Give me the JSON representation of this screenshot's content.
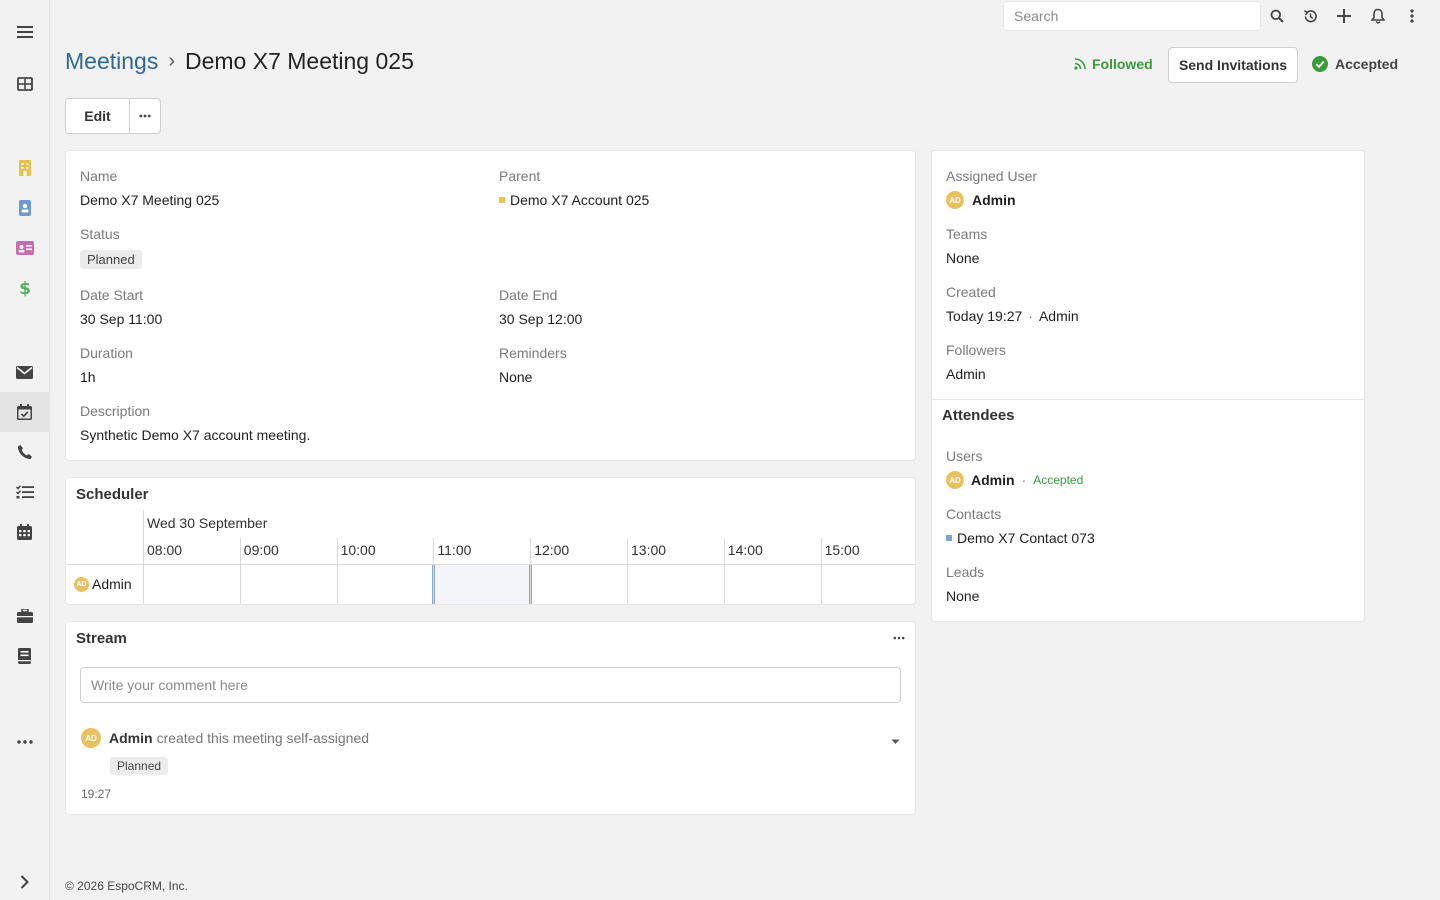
{
  "topbar": {
    "search_placeholder": "Search"
  },
  "header": {
    "breadcrumb_parent": "Meetings",
    "breadcrumb_separator": "›",
    "title": "Demo X7 Meeting 025",
    "followed_label": "Followed",
    "send_invitations_label": "Send Invitations",
    "acceptance_label": "Accepted",
    "edit_label": "Edit"
  },
  "details": {
    "name_label": "Name",
    "name_value": "Demo X7 Meeting 025",
    "parent_label": "Parent",
    "parent_value": "Demo X7 Account 025",
    "status_label": "Status",
    "status_value": "Planned",
    "date_start_label": "Date Start",
    "date_start_value": "30 Sep 11:00",
    "date_end_label": "Date End",
    "date_end_value": "30 Sep 12:00",
    "duration_label": "Duration",
    "duration_value": "1h",
    "reminders_label": "Reminders",
    "reminders_value": "None",
    "description_label": "Description",
    "description_value": "Synthetic Demo X7 account meeting."
  },
  "side": {
    "assigned_user_label": "Assigned User",
    "assigned_user_value": "Admin",
    "avatar_initials": "AD",
    "teams_label": "Teams",
    "teams_value": "None",
    "created_label": "Created",
    "created_time": "Today 19:27",
    "created_dot": "·",
    "created_by": "Admin",
    "followers_label": "Followers",
    "followers_value": "Admin",
    "attendees_title": "Attendees",
    "users_label": "Users",
    "users_value": "Admin",
    "users_dot": "·",
    "users_status": "Accepted",
    "contacts_label": "Contacts",
    "contacts_value": "Demo X7 Contact 073",
    "leads_label": "Leads",
    "leads_value": "None"
  },
  "scheduler": {
    "title": "Scheduler",
    "date_label": "Wed 30 September",
    "times": [
      "08:00",
      "09:00",
      "10:00",
      "11:00",
      "12:00",
      "13:00",
      "14:00",
      "15:00"
    ],
    "row_user": "Admin",
    "avatar_initials": "AD"
  },
  "stream": {
    "title": "Stream",
    "comment_placeholder": "Write your comment here",
    "note_user": "Admin",
    "note_text": "created this meeting self-assigned",
    "note_status": "Planned",
    "note_time": "19:27",
    "avatar_initials": "AD"
  },
  "footer": {
    "text": "© 2026 EspoCRM, Inc."
  },
  "colors": {
    "link": "#2f6797",
    "followed": "#3a9b3a",
    "accepted_icon": "#3a9b3a",
    "avatar": "#e9c15e",
    "account_square": "#e9c15e",
    "contact_square": "#7aa3d0",
    "scheduler_edge": "#8aa8c8"
  },
  "icons": {
    "sidebar": [
      "menu-icon",
      "dashboard-icon",
      "accounts-icon",
      "contacts-icon",
      "leads-icon",
      "opportunities-icon",
      "email-icon",
      "meetings-icon",
      "calls-icon",
      "tasks-icon",
      "calendar-icon",
      "cases-icon",
      "documents-icon",
      "more-icon",
      "expand-icon"
    ],
    "topbar": [
      "search-icon",
      "history-icon",
      "plus-icon",
      "bell-icon",
      "kebab-menu-icon"
    ]
  }
}
